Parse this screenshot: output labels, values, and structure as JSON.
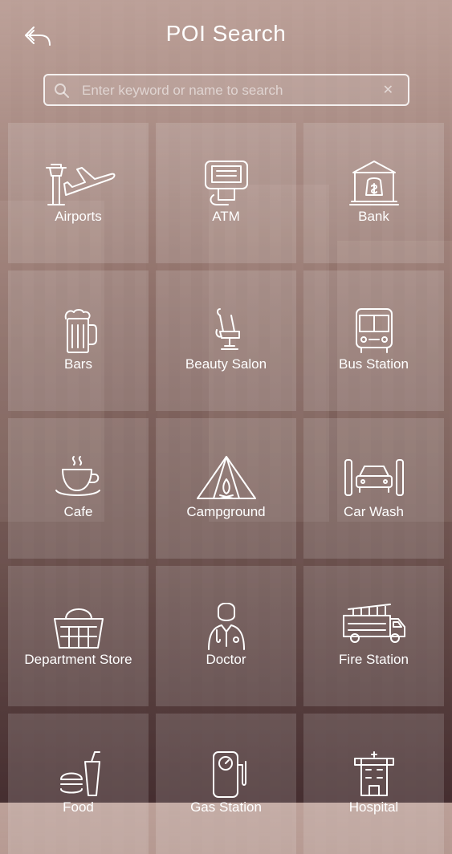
{
  "header": {
    "title": "POI Search",
    "back_icon": "back-arrow-icon"
  },
  "search": {
    "placeholder": "Enter keyword or name to search",
    "value": "",
    "clear_symbol": "✕"
  },
  "categories": [
    {
      "label": "Airports",
      "icon": "airport-icon"
    },
    {
      "label": "ATM",
      "icon": "atm-icon"
    },
    {
      "label": "Bank",
      "icon": "bank-icon"
    },
    {
      "label": "Bars",
      "icon": "beer-mug-icon"
    },
    {
      "label": "Beauty Salon",
      "icon": "salon-chair-icon"
    },
    {
      "label": "Bus Station",
      "icon": "bus-icon"
    },
    {
      "label": "Cafe",
      "icon": "coffee-cup-icon"
    },
    {
      "label": "Campground",
      "icon": "tent-icon"
    },
    {
      "label": "Car Wash",
      "icon": "car-wash-icon"
    },
    {
      "label": "Department Store",
      "icon": "shopping-basket-icon"
    },
    {
      "label": "Doctor",
      "icon": "doctor-icon"
    },
    {
      "label": "Fire Station",
      "icon": "fire-truck-icon"
    },
    {
      "label": "Food",
      "icon": "burger-drink-icon"
    },
    {
      "label": "Gas Station",
      "icon": "gas-pump-icon"
    },
    {
      "label": "Hospital",
      "icon": "hospital-icon"
    }
  ],
  "colors": {
    "text": "#ffffff",
    "tile_overlay": "rgba(255,255,255,0.14)"
  }
}
